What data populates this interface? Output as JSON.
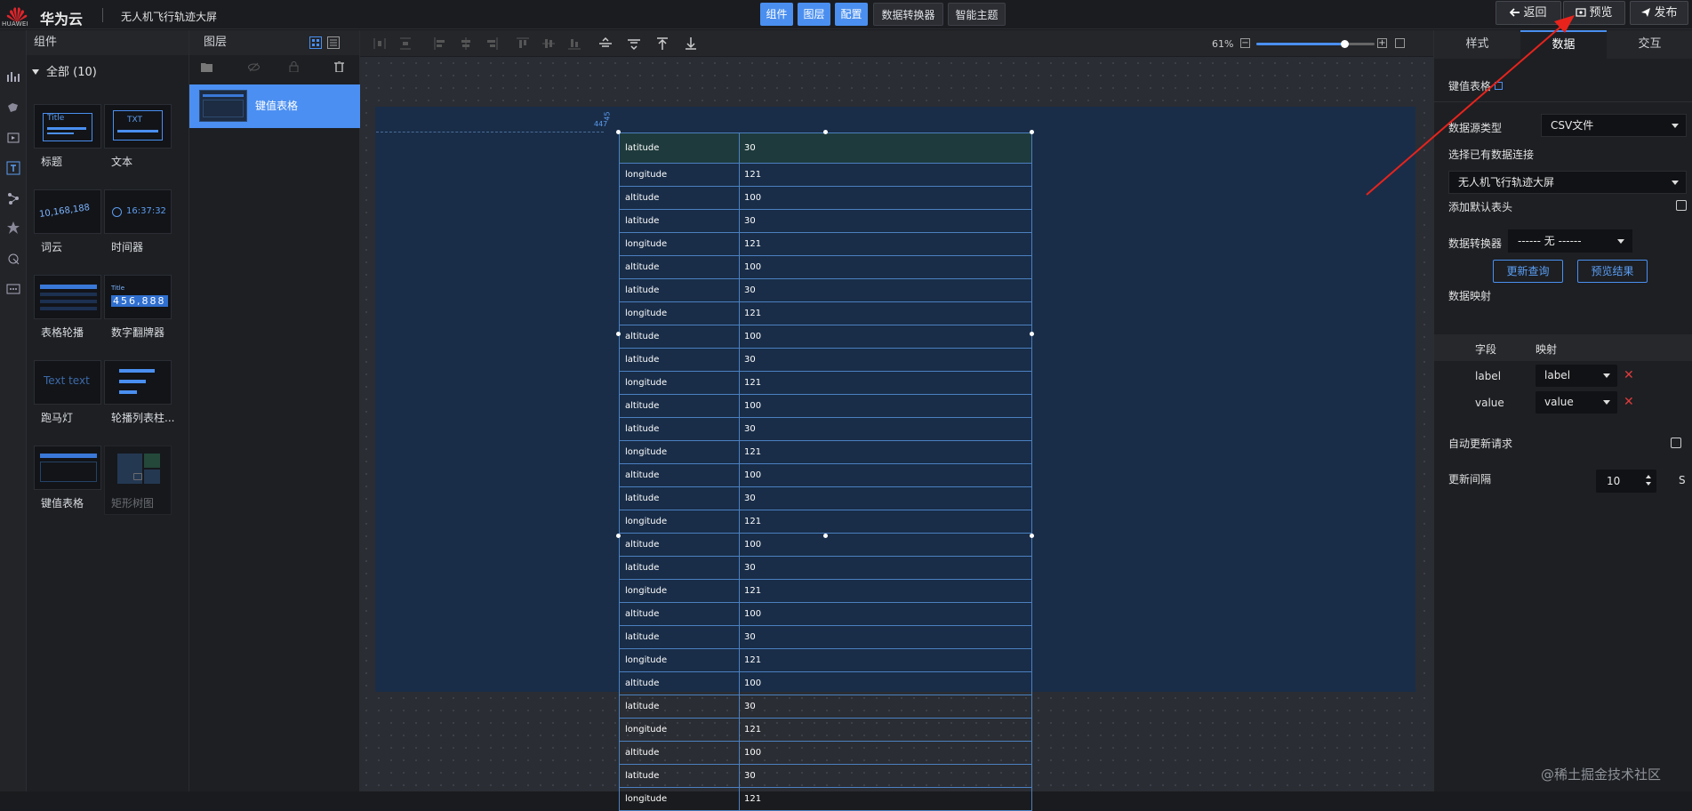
{
  "brand": {
    "logo_text": "HUAWEI",
    "name": "华为云"
  },
  "project_name": "无人机飞行轨迹大屏",
  "top_tabs": [
    {
      "label": "组件",
      "active": true
    },
    {
      "label": "图层",
      "active": true
    },
    {
      "label": "配置",
      "active": true
    },
    {
      "label": "数据转换器",
      "active": false
    },
    {
      "label": "智能主题",
      "active": false
    }
  ],
  "top_actions": {
    "back": "返回",
    "preview": "预览",
    "publish": "发布"
  },
  "components_panel": {
    "title": "组件",
    "group_label": "全部 (10)",
    "items": [
      {
        "label": "标题",
        "thumb_text": "Title"
      },
      {
        "label": "文本",
        "thumb_text": "TXT"
      },
      {
        "label": "词云",
        "thumb_text": "10,168,188"
      },
      {
        "label": "时间器",
        "thumb_text": "16:37:32"
      },
      {
        "label": "表格轮播",
        "thumb_text": ""
      },
      {
        "label": "数字翻牌器",
        "thumb_text": "456,888"
      },
      {
        "label": "跑马灯",
        "thumb_text": "Text text"
      },
      {
        "label": "轮播列表柱...",
        "thumb_text": ""
      },
      {
        "label": "键值表格",
        "thumb_text": ""
      },
      {
        "label": "矩形树图",
        "thumb_text": ""
      }
    ]
  },
  "layers_panel": {
    "title": "图层",
    "items": [
      {
        "label": "键值表格"
      }
    ]
  },
  "canvas": {
    "zoom_text": "61%",
    "zoom_value": 0.61,
    "ruler_v": "45",
    "ruler_h": "447",
    "kv_rows": [
      {
        "key": "latitude",
        "value": "30"
      },
      {
        "key": "longitude",
        "value": "121"
      },
      {
        "key": "altitude",
        "value": "100"
      },
      {
        "key": "latitude",
        "value": "30"
      },
      {
        "key": "longitude",
        "value": "121"
      },
      {
        "key": "altitude",
        "value": "100"
      },
      {
        "key": "latitude",
        "value": "30"
      },
      {
        "key": "longitude",
        "value": "121"
      },
      {
        "key": "altitude",
        "value": "100"
      },
      {
        "key": "latitude",
        "value": "30"
      },
      {
        "key": "longitude",
        "value": "121"
      },
      {
        "key": "altitude",
        "value": "100"
      },
      {
        "key": "latitude",
        "value": "30"
      },
      {
        "key": "longitude",
        "value": "121"
      },
      {
        "key": "altitude",
        "value": "100"
      },
      {
        "key": "latitude",
        "value": "30"
      },
      {
        "key": "longitude",
        "value": "121"
      },
      {
        "key": "altitude",
        "value": "100"
      },
      {
        "key": "latitude",
        "value": "30"
      },
      {
        "key": "longitude",
        "value": "121"
      },
      {
        "key": "altitude",
        "value": "100"
      },
      {
        "key": "latitude",
        "value": "30"
      },
      {
        "key": "longitude",
        "value": "121"
      },
      {
        "key": "altitude",
        "value": "100"
      },
      {
        "key": "latitude",
        "value": "30"
      },
      {
        "key": "longitude",
        "value": "121"
      },
      {
        "key": "altitude",
        "value": "100"
      },
      {
        "key": "latitude",
        "value": "30"
      },
      {
        "key": "longitude",
        "value": "121"
      }
    ]
  },
  "right_panel": {
    "tabs": [
      {
        "label": "样式"
      },
      {
        "label": "数据",
        "active": true
      },
      {
        "label": "交互"
      }
    ],
    "component_title": "键值表格",
    "datasource_type_label": "数据源类型",
    "datasource_type_value": "CSV文件",
    "existing_connection_label": "选择已有数据连接",
    "existing_connection_value": "无人机飞行轨迹大屏",
    "add_default_header_label": "添加默认表头",
    "add_default_header_checked": false,
    "converter_label": "数据转换器",
    "converter_value": "------ 无 ------",
    "update_query_button": "更新查询",
    "preview_result_button": "预览结果",
    "mapping_title": "数据映射",
    "mapping_header": {
      "field": "字段",
      "map": "映射"
    },
    "mapping_rows": [
      {
        "field": "label",
        "map": "label"
      },
      {
        "field": "value",
        "map": "value"
      }
    ],
    "auto_update_label": "自动更新请求",
    "auto_update_checked": false,
    "interval_label": "更新间隔",
    "interval_value": "10",
    "interval_unit": "S"
  },
  "watermark": "@稀土掘金技术社区",
  "colors": {
    "accent": "#4a8ff0",
    "screen_bg": "#192d48",
    "annotation_arrow": "#e8231c"
  }
}
